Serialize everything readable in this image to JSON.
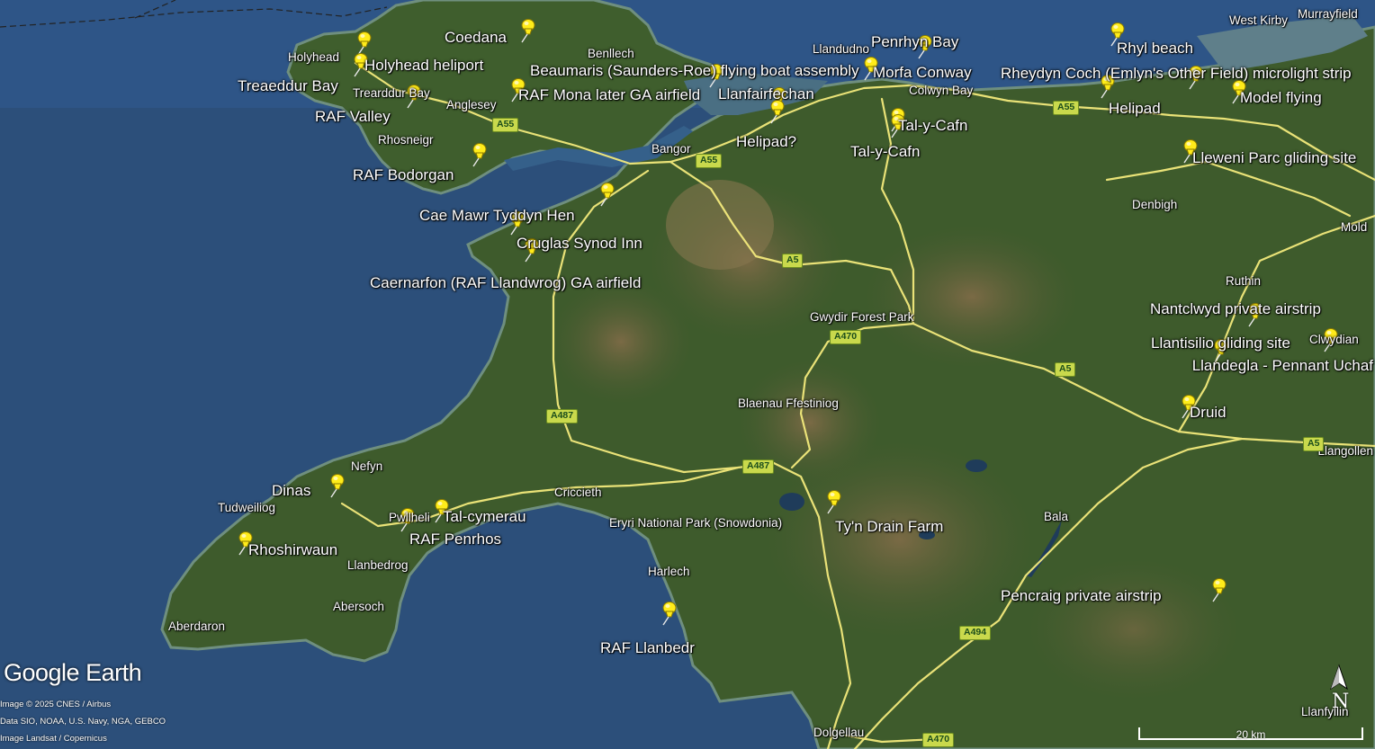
{
  "branding": {
    "logo": "Google Earth",
    "attributions": [
      "Image © 2025 CNES / Airbus",
      "Data SIO, NOAA, U.S. Navy, NGA, GEBCO",
      "Image Landsat / Copernicus"
    ]
  },
  "scale_bar": {
    "label": "20 km"
  },
  "compass": {
    "label": "N"
  },
  "icons": {
    "placemark": "yellow-pushpin-icon",
    "compass": "north-arrow-icon"
  },
  "colors": {
    "sea": "#2c4f7a",
    "land": "#3e5b2c",
    "mountains": "#6b6040",
    "road": "#f3ea7c",
    "pin": "#ffec1a",
    "pin_stroke": "#8a7a00",
    "road_shield": "#c9d94c",
    "label": "#ffffff"
  },
  "placemarks": [
    "Coedana",
    "Holyhead heliport",
    "Treaeddur Bay",
    "RAF Valley",
    "RAF Mona later GA airfield",
    "Beaumaris (Saunders-Roe) flying boat assembly",
    "Llanfairfechan",
    "Helipad?",
    "Penrhyn Bay",
    "Morfa Conway",
    "Tal-y-Cafn",
    "Tal-y-Cafn",
    "Rhyl  beach",
    "Rheydyn Coch (Emlyn's Other Field) microlight strip",
    "Helipad",
    "Model flying",
    "Lleweni Parc gliding site",
    "RAF Bodorgan",
    "Cae Mawr Tyddyn Hen",
    "Cruglas Synod Inn",
    "Caernarfon (RAF Llandwrog) GA airfield",
    "Nantclwyd private airstrip",
    "Llantisilio gliding site",
    "Llandegla - Pennant Uchaf",
    "Druid",
    "Dinas",
    "Tal-cymerau",
    "RAF Penrhos",
    "Rhoshirwaun",
    "Ty'n Drain Farm",
    "Pencraig private airstrip",
    "RAF Llanbedr"
  ],
  "places": [
    "Holyhead",
    "Trearddur Bay",
    "Rhosneigr",
    "Anglesey",
    "Benllech",
    "Bangor",
    "Llandudno",
    "Colwyn Bay",
    "West Kirby",
    "Murrayfield",
    "Denbigh",
    "Mold",
    "Ruthin",
    "Clwydian",
    "Gwydir Forest Park",
    "Blaenau Ffestiniog",
    "Nefyn",
    "Tudweiliog",
    "Pwllheli",
    "Criccieth",
    "Llanbedrog",
    "Abersoch",
    "Aberdaron",
    "Eryri National Park (Snowdonia)",
    "Harlech",
    "Bala",
    "Dolgellau",
    "Llanfyllin",
    "Llangollen"
  ],
  "roads": [
    "A55",
    "A55",
    "A55",
    "A5",
    "A5",
    "A5",
    "A470",
    "A470",
    "A487",
    "A487",
    "A494"
  ]
}
